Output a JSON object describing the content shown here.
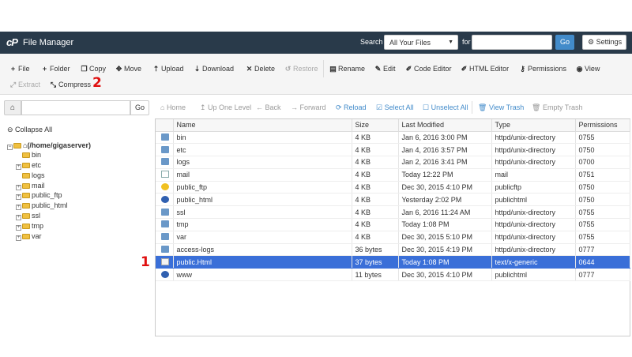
{
  "header": {
    "logo": "cP",
    "title": "File Manager",
    "search_label": "Search",
    "search_scope": "All Your Files",
    "for_label": "for",
    "search_placeholder": "",
    "go_label": "Go",
    "settings_label": "Settings"
  },
  "toolbar": {
    "file": "File",
    "folder": "Folder",
    "copy": "Copy",
    "move": "Move",
    "upload": "Upload",
    "download": "Download",
    "delete": "Delete",
    "restore": "Restore",
    "rename": "Rename",
    "edit": "Edit",
    "code_editor": "Code Editor",
    "html_editor": "HTML Editor",
    "permissions": "Permissions",
    "view": "View",
    "extract": "Extract",
    "compress": "Compress"
  },
  "markers": {
    "one": "1",
    "two": "2"
  },
  "pathbar": {
    "go_label": "Go",
    "home": "Home",
    "up_one_level": "Up One Level",
    "back": "Back",
    "forward": "Forward",
    "reload": "Reload",
    "select_all": "Select All",
    "unselect_all": "Unselect All",
    "view_trash": "View Trash",
    "empty_trash": "Empty Trash"
  },
  "tree": {
    "collapse_all": "Collapse All",
    "root": "(/home/gigaserver)",
    "items": [
      "bin",
      "etc",
      "logs",
      "mail",
      "public_ftp",
      "public_html",
      "ssl",
      "tmp",
      "var"
    ]
  },
  "table": {
    "headers": [
      "Name",
      "Size",
      "Last Modified",
      "Type",
      "Permissions"
    ],
    "rows": [
      {
        "icon": "folder",
        "name": "bin",
        "size": "4 KB",
        "modified": "Jan 6, 2016 3:00 PM",
        "type": "httpd/unix-directory",
        "perms": "0755"
      },
      {
        "icon": "folder",
        "name": "etc",
        "size": "4 KB",
        "modified": "Jan 4, 2016 3:57 PM",
        "type": "httpd/unix-directory",
        "perms": "0750"
      },
      {
        "icon": "folder",
        "name": "logs",
        "size": "4 KB",
        "modified": "Jan 2, 2016 3:41 PM",
        "type": "httpd/unix-directory",
        "perms": "0700"
      },
      {
        "icon": "mail",
        "name": "mail",
        "size": "4 KB",
        "modified": "Today 12:22 PM",
        "type": "mail",
        "perms": "0751"
      },
      {
        "icon": "ftp",
        "name": "public_ftp",
        "size": "4 KB",
        "modified": "Dec 30, 2015 4:10 PM",
        "type": "publicftp",
        "perms": "0750"
      },
      {
        "icon": "globe",
        "name": "public_html",
        "size": "4 KB",
        "modified": "Yesterday 2:02 PM",
        "type": "publichtml",
        "perms": "0750"
      },
      {
        "icon": "folder",
        "name": "ssl",
        "size": "4 KB",
        "modified": "Jan 6, 2016 11:24 AM",
        "type": "httpd/unix-directory",
        "perms": "0755"
      },
      {
        "icon": "folder",
        "name": "tmp",
        "size": "4 KB",
        "modified": "Today 1:08 PM",
        "type": "httpd/unix-directory",
        "perms": "0755"
      },
      {
        "icon": "folder",
        "name": "var",
        "size": "4 KB",
        "modified": "Dec 30, 2015 5:10 PM",
        "type": "httpd/unix-directory",
        "perms": "0755"
      },
      {
        "icon": "folder",
        "name": "access-logs",
        "size": "36 bytes",
        "modified": "Dec 30, 2015 4:19 PM",
        "type": "httpd/unix-directory",
        "perms": "0777"
      },
      {
        "icon": "doc",
        "name": "public.Html",
        "size": "37 bytes",
        "modified": "Today 1:08 PM",
        "type": "text/x-generic",
        "perms": "0644",
        "selected": true
      },
      {
        "icon": "globe",
        "name": "www",
        "size": "11 bytes",
        "modified": "Dec 30, 2015 4:10 PM",
        "type": "publichtml",
        "perms": "0777"
      }
    ]
  },
  "colors": {
    "header_bg": "#293a4a",
    "selected_row": "#3a6fd8",
    "accent": "#428bca",
    "marker": "#e01010"
  }
}
